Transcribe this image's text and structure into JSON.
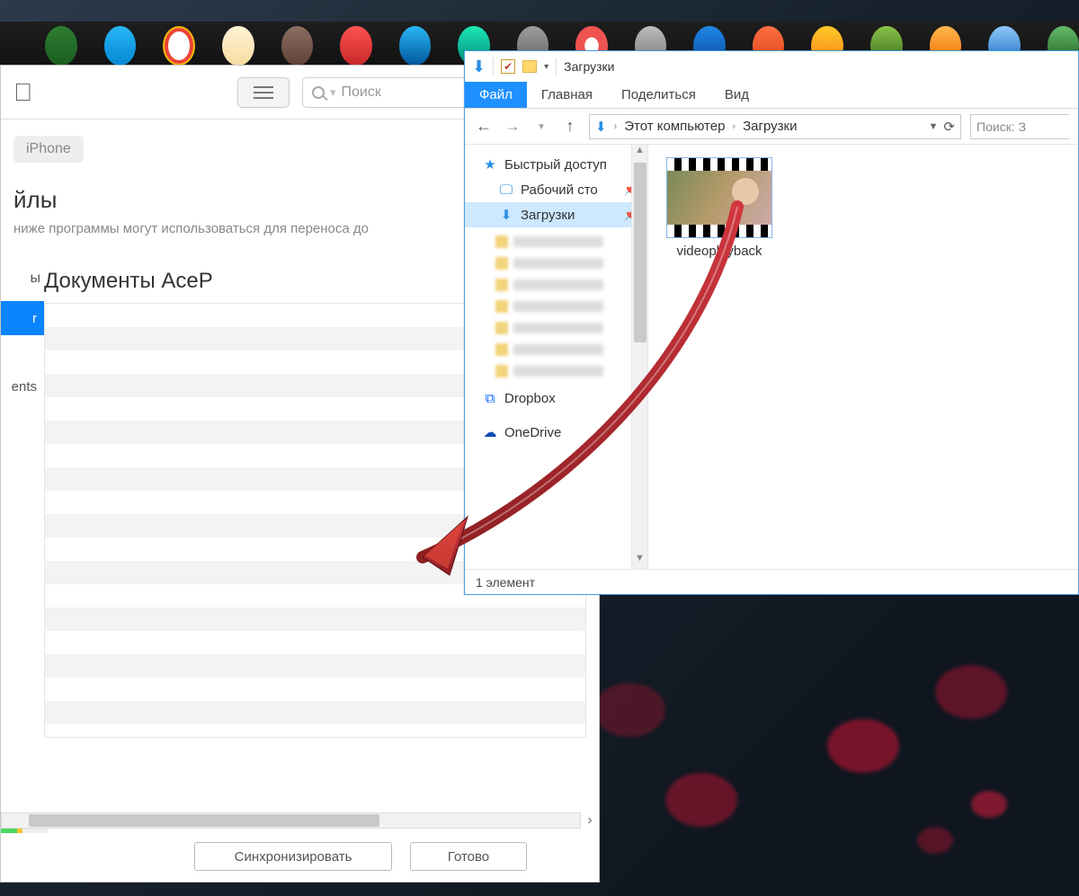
{
  "taskbar": {
    "icons": [
      "excel",
      "telegram",
      "chrome-like",
      "weather",
      "gimp",
      "opera",
      "skype",
      "geo",
      "btn-gray",
      "target",
      "btn-gray2",
      "edge",
      "movavi",
      "potplayer",
      "torrent",
      "printer",
      "screenshot",
      "store"
    ]
  },
  "itunes": {
    "search_placeholder": "Поиск",
    "device_chip": "iPhone",
    "section_title_fragment": "йлы",
    "section_desc": "ниже программы могут использоваться для переноса до",
    "left_header_fragment": "ы",
    "left_rows": [
      {
        "label": "r",
        "active": true
      },
      {
        "label": "",
        "active": false
      },
      {
        "label": "ents",
        "active": false
      }
    ],
    "docs_title": "Документы AceP",
    "sync_button": "Синхронизировать",
    "done_button": "Готово"
  },
  "explorer": {
    "title": "Загрузки",
    "ribbon": {
      "file": "Файл",
      "home": "Главная",
      "share": "Поделиться",
      "view": "Вид"
    },
    "path": {
      "root": "Этот компьютер",
      "leaf": "Загрузки"
    },
    "search_placeholder": "Поиск: З",
    "sidebar": {
      "quick_access": "Быстрый доступ",
      "desktop": "Рабочий сто",
      "downloads": "Загрузки",
      "dropbox": "Dropbox",
      "onedrive": "OneDrive"
    },
    "file": {
      "name": "videoplayback"
    },
    "status": "1 элемент"
  }
}
